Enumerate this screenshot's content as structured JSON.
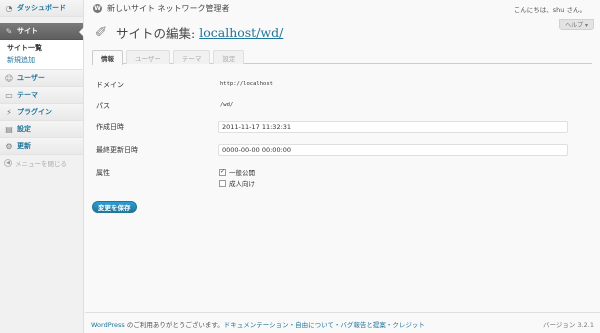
{
  "sidebar": {
    "dashboard": "ダッシュボード",
    "sites": "サイト",
    "sites_sub": [
      "サイト一覧",
      "新規追加"
    ],
    "users": "ユーザー",
    "themes": "テーマ",
    "plugins": "プラグイン",
    "settings": "設定",
    "updates": "更新",
    "collapse": "メニューを閉じる"
  },
  "header": {
    "site_title": "新しいサイト ネットワーク管理者",
    "howdy": "こんにちは、shu さん。",
    "help": "ヘルプ ▾"
  },
  "page": {
    "title": "サイトの編集:",
    "title_link": "localhost/wd/"
  },
  "tabs": [
    "情報",
    "ユーザー",
    "テーマ",
    "設定"
  ],
  "form": {
    "domain_label": "ドメイン",
    "domain_value": "http://localhost",
    "path_label": "パス",
    "path_value": "/wd/",
    "registered_label": "作成日時",
    "registered_value": "2011-11-17 11:32:31",
    "updated_label": "最終更新日時",
    "updated_value": "0000-00-00 00:00:00",
    "attributes_label": "属性",
    "attr_public": "一般公開",
    "attr_mature": "成人向け",
    "attr_public_checked": true,
    "attr_mature_checked": false
  },
  "buttons": {
    "save": "変更を保存"
  },
  "footer": {
    "wordpress": "WordPress",
    "thanks": " のご利用ありがとうございます。",
    "links": "ドキュメンテーション・自由について・バグ報告と提案・クレジット",
    "version": "バージョン 3.2.1"
  },
  "icons": {
    "dashboard": "dashboard-icon",
    "sites": "sites-icon",
    "users": "users-icon",
    "themes": "themes-icon",
    "plugins": "plugins-icon",
    "settings": "settings-icon",
    "updates": "updates-icon"
  },
  "colors": {
    "link": "#21759b",
    "current_menu": "#6d6d6d",
    "button": "#21759b"
  }
}
